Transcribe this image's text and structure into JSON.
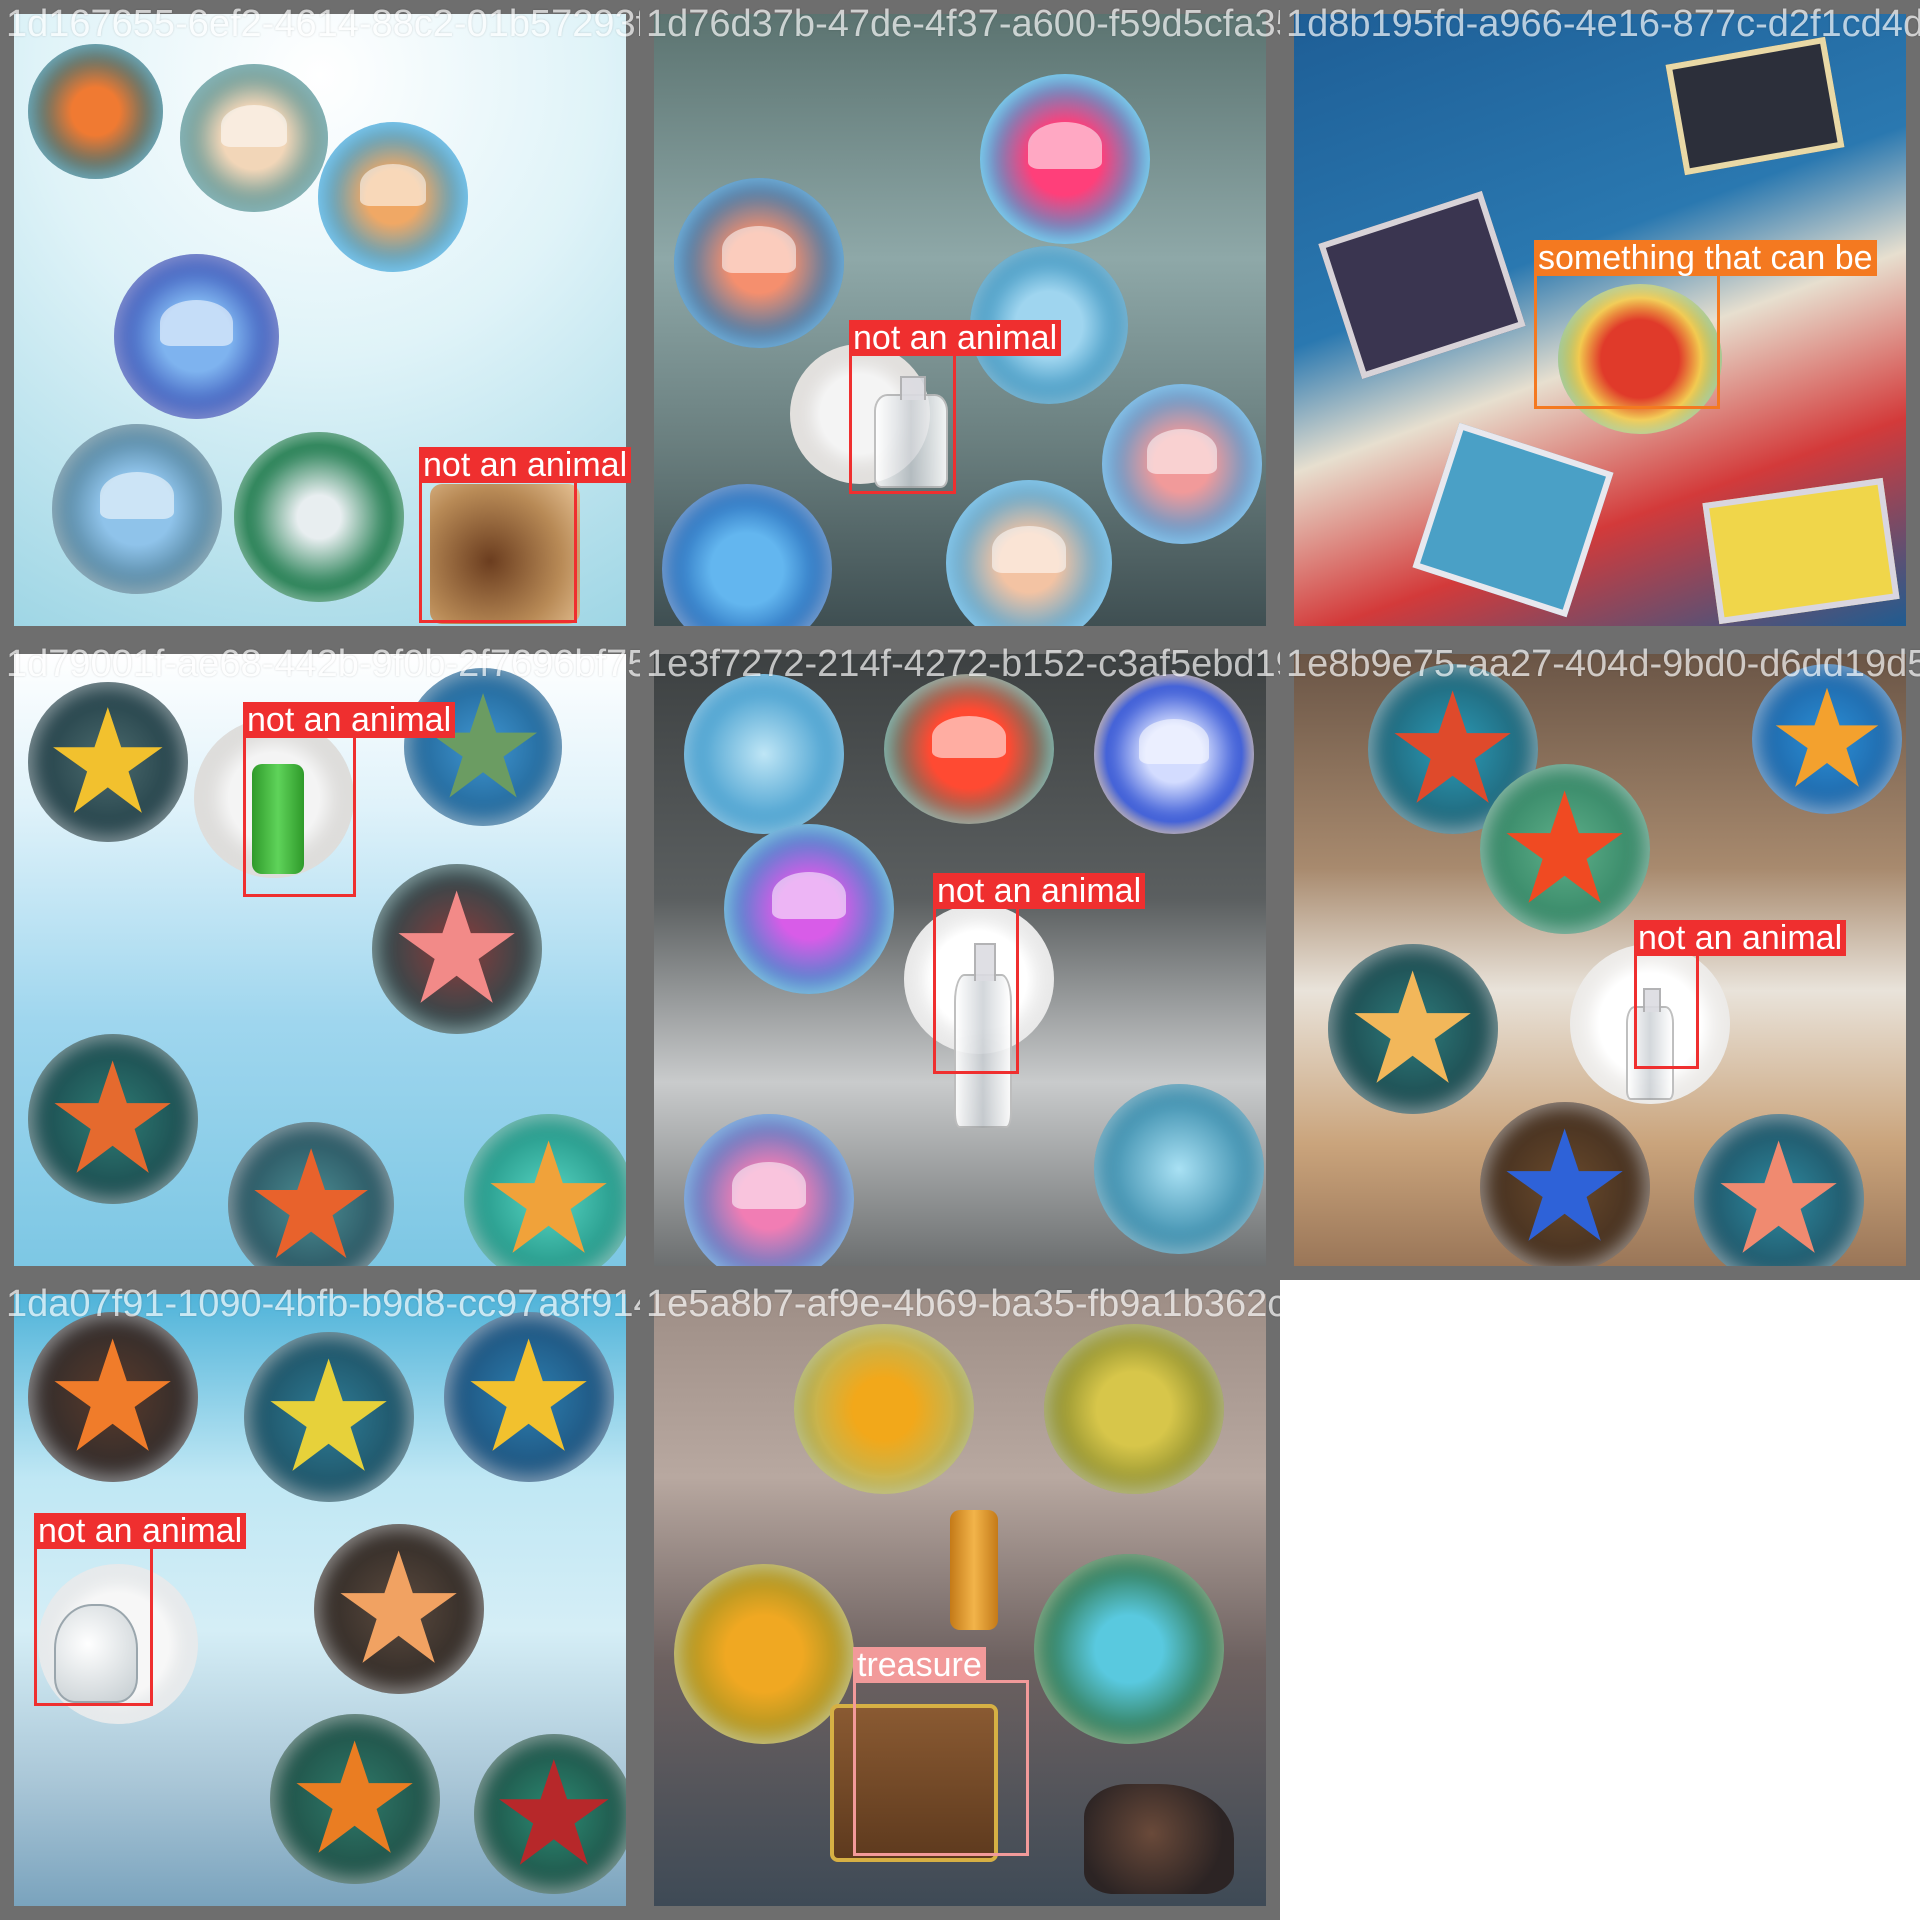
{
  "tiles": [
    {
      "filename": "1d167655-6ef2-4614-88c2-01b57293f96a.jpg",
      "label": "not an animal",
      "label_color": "#ef2f2f",
      "detected_object": "boots"
    },
    {
      "filename": "1d76d37b-47de-4f37-a600-f59d5cfa358b.jpg",
      "label": "not an animal",
      "label_color": "#ef2f2f",
      "detected_object": "bottle"
    },
    {
      "filename": "1d8b195fd-a966-4e16-877c-d2f1cd4da",
      "label": "something that can be",
      "label_color": "#f47920",
      "detected_object": "pizza"
    },
    {
      "filename": "1d79001f-ae68-442b-9f0b-2f7696bf751c.jpg",
      "label": "not an animal",
      "label_color": "#ef2f2f",
      "detected_object": "green-bottle"
    },
    {
      "filename": "1e3f7272-214f-4272-b152-c3af5ebd1968.jpg",
      "label": "not an animal",
      "label_color": "#ef2f2f",
      "detected_object": "bottle"
    },
    {
      "filename": "1e8b9e75-aa27-404d-9bd0-d6dd19d5",
      "label": "not an animal",
      "label_color": "#ef2f2f",
      "detected_object": "bottle"
    },
    {
      "filename": "1da07f91-1090-4bfb-b9d8-cc97a8f914454.jpg",
      "label": "not an animal",
      "label_color": "#ef2f2f",
      "detected_object": "jug"
    },
    {
      "filename": "1e5a8b7-af9e-4b69-ba35-fb9a1b362c47.jpg",
      "label": "treasure",
      "label_color": "#f29a9a",
      "detected_object": "treasure-chest"
    }
  ]
}
